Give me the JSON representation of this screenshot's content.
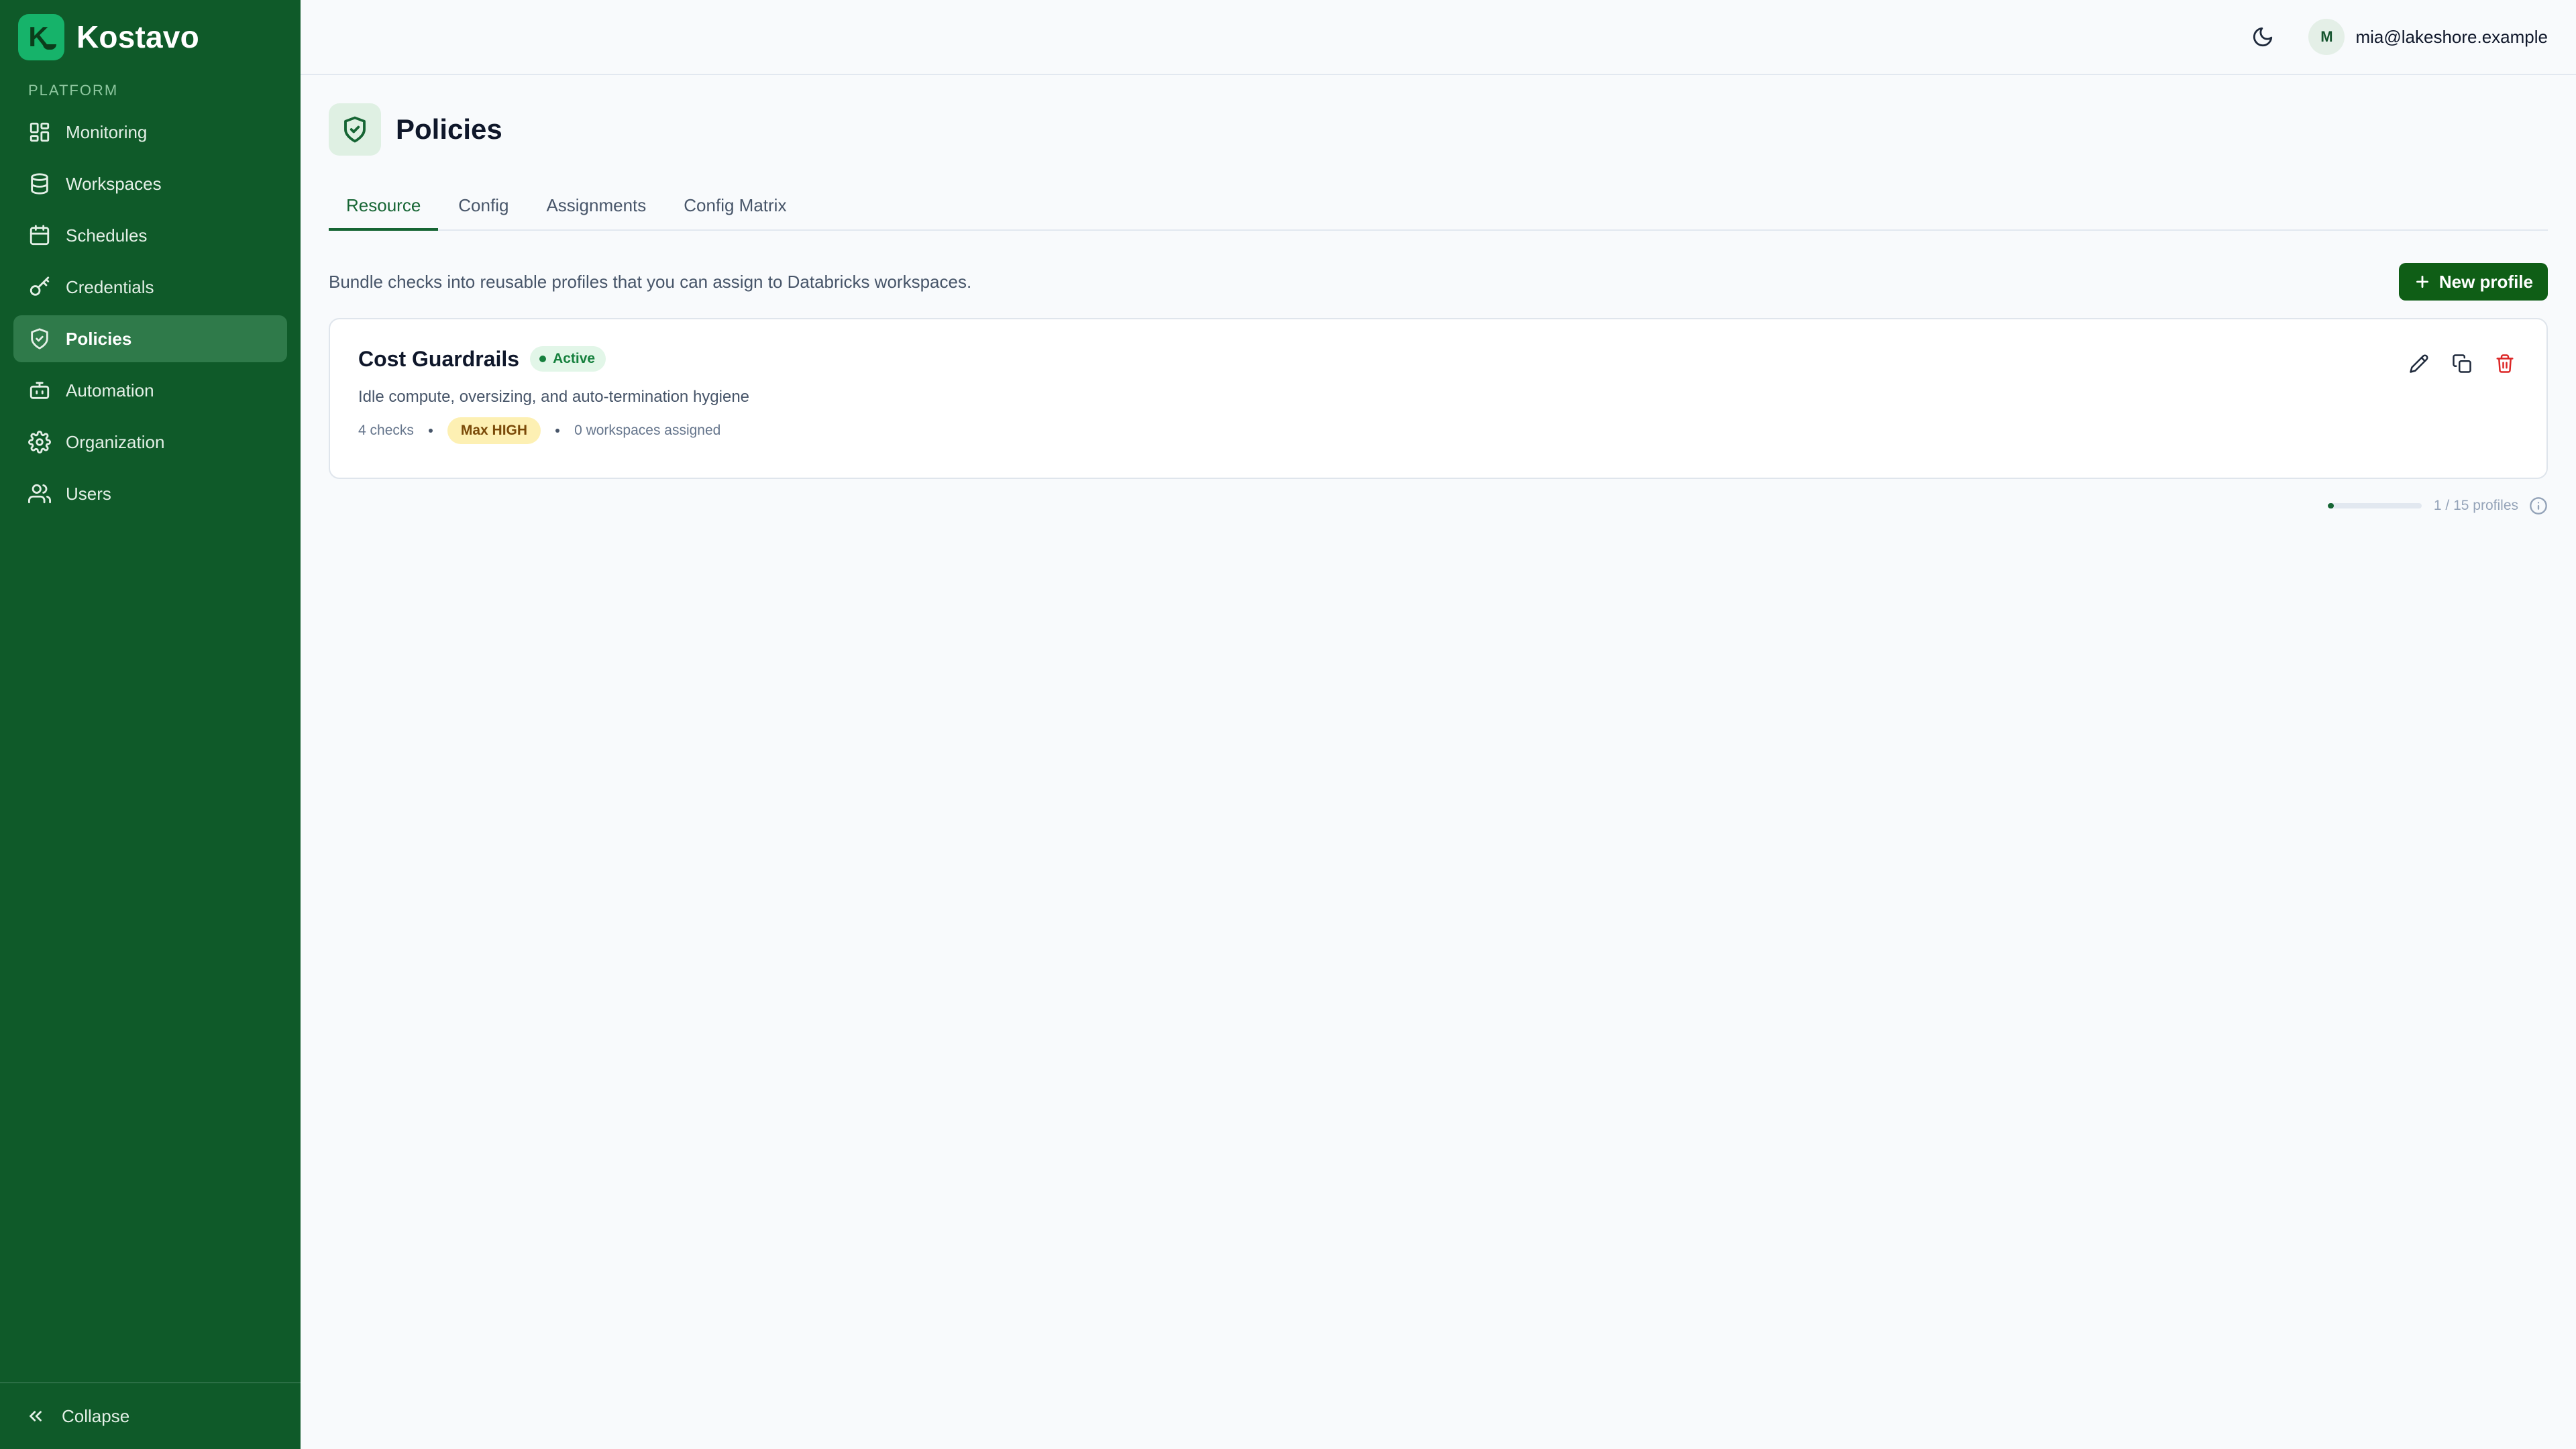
{
  "app": {
    "name": "Kostavo",
    "logo_letter": "K"
  },
  "sidebar": {
    "section_label": "PLATFORM",
    "items": [
      {
        "label": "Monitoring",
        "icon": "grid-icon",
        "active": false
      },
      {
        "label": "Workspaces",
        "icon": "database-icon",
        "active": false
      },
      {
        "label": "Schedules",
        "icon": "calendar-icon",
        "active": false
      },
      {
        "label": "Credentials",
        "icon": "key-icon",
        "active": false
      },
      {
        "label": "Policies",
        "icon": "shield-check-icon",
        "active": true
      },
      {
        "label": "Automation",
        "icon": "bot-icon",
        "active": false
      },
      {
        "label": "Organization",
        "icon": "gear-icon",
        "active": false
      },
      {
        "label": "Users",
        "icon": "users-icon",
        "active": false
      }
    ],
    "collapse_label": "Collapse"
  },
  "topbar": {
    "user_initial": "M",
    "user_email": "mia@lakeshore.example"
  },
  "page": {
    "title": "Policies",
    "tabs": [
      {
        "label": "Resource",
        "active": true
      },
      {
        "label": "Config",
        "active": false
      },
      {
        "label": "Assignments",
        "active": false
      },
      {
        "label": "Config Matrix",
        "active": false
      }
    ],
    "description": "Bundle checks into reusable profiles that you can assign to Databricks workspaces.",
    "new_button_label": "New profile"
  },
  "profiles": [
    {
      "name": "Cost Guardrails",
      "status": "Active",
      "description": "Idle compute, oversizing, and auto-termination hygiene",
      "checks": "4 checks",
      "max_severity": "Max HIGH",
      "assigned": "0 workspaces assigned"
    }
  ],
  "quota": {
    "label": "1 / 15 profiles",
    "used": 1,
    "total": 15
  },
  "colors": {
    "sidebar_bg": "#0f5a29",
    "accent": "#166534",
    "primary_button": "#0f5e16",
    "active_badge_bg": "#e2f6e8",
    "severity_badge_bg": "#fdf0b3",
    "danger": "#dc2626"
  }
}
